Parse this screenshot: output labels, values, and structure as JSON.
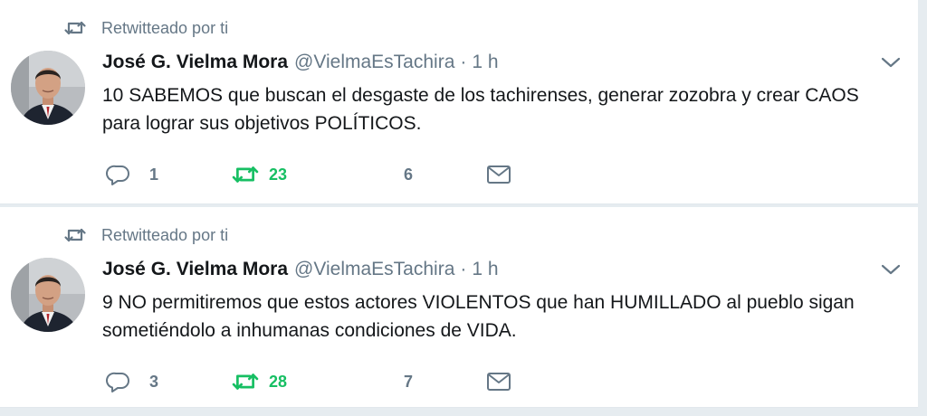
{
  "colors": {
    "background": "#e6ecf0",
    "card": "#ffffff",
    "text": "#14171a",
    "muted": "#657786",
    "retweeted": "#17bf63"
  },
  "tweets": [
    {
      "context": "Retwitteado por ti",
      "context_icon": "retweet-icon",
      "author": {
        "fullname": "José G. Vielma Mora",
        "username": "@VielmaEsTachira",
        "avatar": "avatar-photo"
      },
      "separator": "·",
      "time": "1 h",
      "text": "10 SABEMOS que buscan el desgaste de los tachirenses, generar zozobra y crear CAOS para lograr sus objetivos POLÍTICOS.",
      "replies": "1",
      "retweets": "23",
      "retweeted": true,
      "likes": "6",
      "icons": [
        "reply-icon",
        "retweet-icon",
        "like-icon",
        "direct-message-icon",
        "chevron-down-icon"
      ]
    },
    {
      "context": "Retwitteado por ti",
      "context_icon": "retweet-icon",
      "author": {
        "fullname": "José G. Vielma Mora",
        "username": "@VielmaEsTachira",
        "avatar": "avatar-photo"
      },
      "separator": "·",
      "time": "1 h",
      "text": "9 NO permitiremos que estos actores VIOLENTOS que han HUMILLADO al pueblo sigan sometiéndolo a inhumanas condiciones de VIDA.",
      "replies": "3",
      "retweets": "28",
      "retweeted": true,
      "likes": "7",
      "icons": [
        "reply-icon",
        "retweet-icon",
        "like-icon",
        "direct-message-icon",
        "chevron-down-icon"
      ]
    }
  ]
}
